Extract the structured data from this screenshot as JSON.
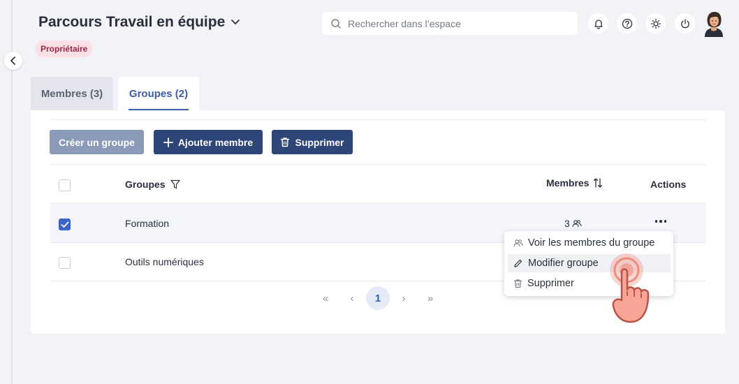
{
  "header": {
    "title": "Parcours Travail en équipe",
    "badge": "Propriétaire"
  },
  "search": {
    "placeholder": "Rechercher dans l’espace"
  },
  "top_icons": [
    "bell-icon",
    "help-icon",
    "sun-icon",
    "power-icon",
    "avatar"
  ],
  "tabs": [
    {
      "label": "Membres (3)",
      "active": false
    },
    {
      "label": "Groupes (2)",
      "active": true
    }
  ],
  "toolbar": {
    "create_label": "Créer un groupe",
    "add_label": "Ajouter membre",
    "delete_label": "Supprimer"
  },
  "table": {
    "headers": {
      "groups": "Groupes",
      "members": "Membres",
      "actions": "Actions"
    },
    "rows": [
      {
        "name": "Formation",
        "members": "3",
        "checked": true
      },
      {
        "name": "Outils numériques",
        "members": "",
        "checked": false
      }
    ]
  },
  "pagination": {
    "first": "«",
    "prev": "‹",
    "current": "1",
    "next": "›",
    "last": "»"
  },
  "context_menu": {
    "items": [
      {
        "label": "Voir les membres du groupe",
        "icon": "users-icon"
      },
      {
        "label": "Modifier groupe",
        "icon": "pencil-icon",
        "hovered": true
      },
      {
        "label": "Supprimer",
        "icon": "trash-icon"
      }
    ]
  },
  "colors": {
    "primary": "#2e4577",
    "accent": "#3c5ea9",
    "badge_bg": "#fbe1e6",
    "badge_text": "#9c2543",
    "cursor": "#f08a7b"
  }
}
